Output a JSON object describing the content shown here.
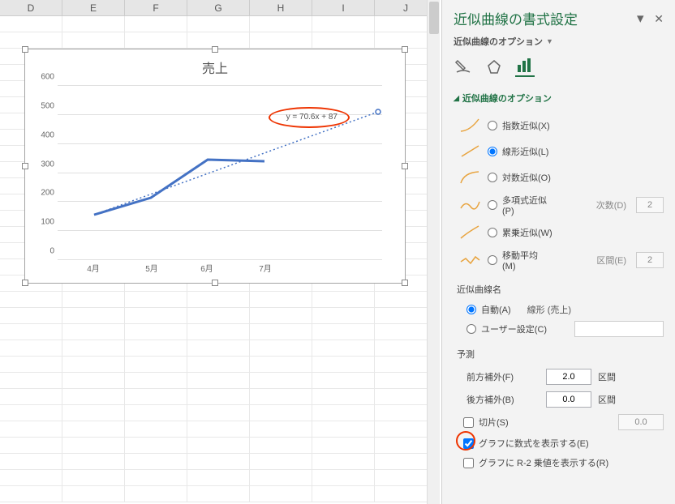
{
  "columns": [
    "D",
    "E",
    "F",
    "G",
    "H",
    "I",
    "J"
  ],
  "chart": {
    "title": "売上",
    "equation": "y = 70.6x + 87",
    "y_ticks": [
      "0",
      "100",
      "200",
      "300",
      "400",
      "500",
      "600"
    ],
    "x_ticks": [
      "4月",
      "5月",
      "6月",
      "7月"
    ]
  },
  "chart_data": {
    "type": "line",
    "title": "売上",
    "categories": [
      "4月",
      "5月",
      "6月",
      "7月"
    ],
    "series": [
      {
        "name": "売上",
        "values": [
          155,
          215,
          345,
          340
        ]
      }
    ],
    "trendline": {
      "type": "linear",
      "equation": "y = 70.6x + 87",
      "forecast_forward": 2.0,
      "forecast_backward": 0.0
    },
    "ylim": [
      0,
      600
    ],
    "xlabel": "",
    "ylabel": ""
  },
  "pane": {
    "title": "近似曲線の書式設定",
    "subtitle": "近似曲線のオプション",
    "section": "近似曲線のオプション",
    "options": {
      "exponential": "指数近似(X)",
      "linear": "線形近似(L)",
      "logarithmic": "対数近似(O)",
      "polynomial": "多項式近似(P)",
      "polynomial_order_label": "次数(D)",
      "polynomial_order": "2",
      "power": "累乗近似(W)",
      "moving_avg": "移動平均(M)",
      "moving_avg_period_label": "区間(E)",
      "moving_avg_period": "2"
    },
    "trendline_name": {
      "label": "近似曲線名",
      "auto": "自動(A)",
      "auto_value": "線形 (売上)",
      "custom": "ユーザー設定(C)"
    },
    "forecast": {
      "label": "予測",
      "forward_label": "前方補外(F)",
      "forward_value": "2.0",
      "backward_label": "後方補外(B)",
      "backward_value": "0.0",
      "unit": "区間"
    },
    "intercept": {
      "label": "切片(S)",
      "value": "0.0"
    },
    "show_equation": "グラフに数式を表示する(E)",
    "show_r2": "グラフに R-2 乗値を表示する(R)"
  }
}
